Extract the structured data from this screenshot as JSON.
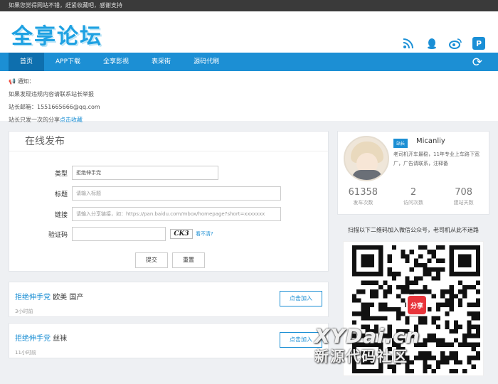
{
  "topbar": {
    "text": "如果您觉得网站不错，赶紧收藏吧，感谢支持"
  },
  "header": {
    "logo": "全享论坛",
    "social": [
      "rss-icon",
      "qq-icon",
      "weibo-icon",
      "pinterest-icon"
    ]
  },
  "nav": {
    "items": [
      "首页",
      "APP下载",
      "全享影视",
      "表采街",
      "源码代刷"
    ],
    "active_index": 0
  },
  "notice": {
    "line1": "📢 通知：",
    "line2": "如果发现违规内容请联系站长举报",
    "line3": "站长邮箱：1551665666@qq.com",
    "line4_prefix": "站长只发一次的分享",
    "line4_link": "点击收藏"
  },
  "form": {
    "title": "在线发布",
    "type_label": "类型",
    "type_value": "拒绝伸手党",
    "title_label": "标题",
    "title_placeholder": "请输入标题",
    "link_label": "链接",
    "link_placeholder": "请输入分享链接，如：https://pan.baidu.com/mbox/homepage?short=xxxxxxx",
    "captcha_label": "验证码",
    "captcha_text": "CK3",
    "captcha_change": "看不清?",
    "submit_label": "提交",
    "reset_label": "重置"
  },
  "posts": [
    {
      "link": "拒绝伸手党",
      "title": "欧美 国产",
      "time": "3小时前",
      "join": "点击加入"
    },
    {
      "link": "拒绝伸手党",
      "title": "丝袜",
      "time": "11小时前",
      "join": "点击加入"
    }
  ],
  "profile": {
    "badge": "站长",
    "name": "Micanliy",
    "desc": "老司机开车最稳，11年专业上车路下宽广，广告请联系，注释备",
    "stats": [
      {
        "num": "61358",
        "label": "发车次数"
      },
      {
        "num": "2",
        "label": "访问次数"
      },
      {
        "num": "708",
        "label": "建站天数"
      }
    ]
  },
  "qr": {
    "title": "扫描以下二维码加入微信公众号，老司机从此不迷路",
    "logo": "分享"
  },
  "watermark": {
    "line1": "XYDai.cn",
    "line2": "新源代码社区"
  },
  "colors": {
    "accent": "#1c8fd4",
    "topbar": "#3a3a3a"
  }
}
